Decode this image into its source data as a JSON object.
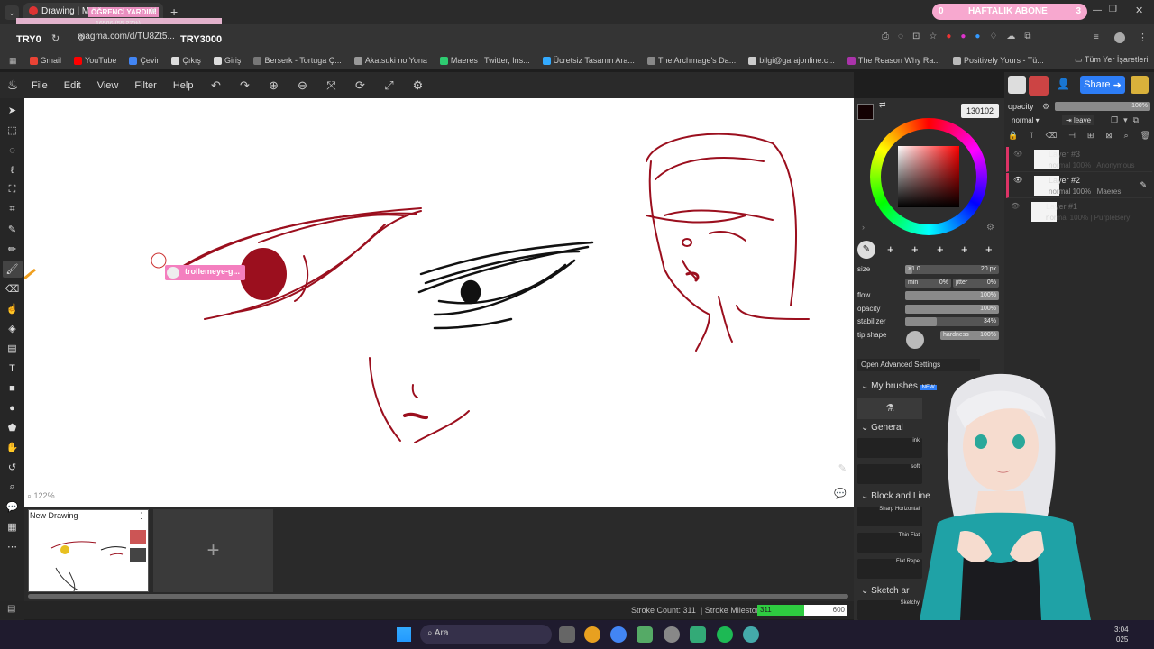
{
  "browser": {
    "tab_title": "Drawing | Magma",
    "overlay_tab": "ÖĞRENCİ YARDIMI",
    "overlay_progress": "16586 (55.27%)",
    "url": "magma.com/d/TU8Zt5...",
    "try_left": "TRY0",
    "try_right": "TRY3000",
    "weekly_label": "HAFTALIK ABONE",
    "weekly_left": "0",
    "weekly_right": "3",
    "bookmarks": [
      "Gmail",
      "YouTube",
      "Çevir",
      "Çıkış",
      "Giriş",
      "Berserk - Tortuga Ç...",
      "Akatsuki no Yona",
      "Maeres | Twitter, Ins...",
      "Ücretsiz Tasarım Ara...",
      "The Archmage's Da...",
      "bilgi@garajonline.c...",
      "The Reason Why Ra...",
      "Positively Yours - Tü...",
      "Tüm Yer İşaretleri"
    ]
  },
  "menu": {
    "file": "File",
    "edit": "Edit",
    "view": "View",
    "filter": "Filter",
    "help": "Help"
  },
  "share_label": "Share",
  "canvas": {
    "zoom": "122%",
    "cursor_label": "trollemeye-g..."
  },
  "drawings": {
    "title": "New Drawing",
    "add": "+"
  },
  "status": {
    "stroke_count": "Stroke Count: 311",
    "milestone_label": "Stroke Milestone:",
    "milestone_value": "311",
    "milestone_max": "600",
    "milestone_fraction": 0.52
  },
  "panel": {
    "color_code": "130102",
    "opacity_label": "opacity",
    "opacity_value": "100%",
    "blend_mode": "normal",
    "leave": "leave",
    "size_label": "size",
    "size_mult": "×1.0",
    "size_value": "20 px",
    "min_label": "min",
    "min_value": "0%",
    "jitter_label": "jitter",
    "jitter_value": "0%",
    "flow_label": "flow",
    "flow_value": "100%",
    "opacity2_label": "opacity",
    "opacity2_value": "100%",
    "stabilizer_label": "stabilizer",
    "stabilizer_value": "34%",
    "stabilizer_fraction": 0.34,
    "tip_label": "tip shape",
    "hardness_label": "hardness",
    "hardness_value": "100%",
    "advanced": "Open Advanced Settings",
    "my_brushes": "My brushes",
    "new_badge": "NEW",
    "general": "General",
    "ink": "ink",
    "soft": "soft",
    "block_line": "Block and Line",
    "sharp_h": "Sharp Horizontal",
    "thin_flat": "Thin Flat",
    "flat_rep": "Flat Repe",
    "sketch": "Sketch ar",
    "sketchy": "Sketchy"
  },
  "layers": [
    {
      "name": "Layer #3",
      "detail": "normal 100% | Anonymous",
      "dim": true
    },
    {
      "name": "Layer #2",
      "detail": "normal 100% | Maeres",
      "dim": false
    },
    {
      "name": "Layer #1",
      "detail": "normal 100% | PurpleBery",
      "dim": true
    }
  ],
  "taskbar": {
    "search": "Ara",
    "time": "3:04",
    "year": "025"
  },
  "colors": {
    "accent": "#2d7df6",
    "stroke_red": "#9b0f1e",
    "milestone": "#2ecc40"
  }
}
